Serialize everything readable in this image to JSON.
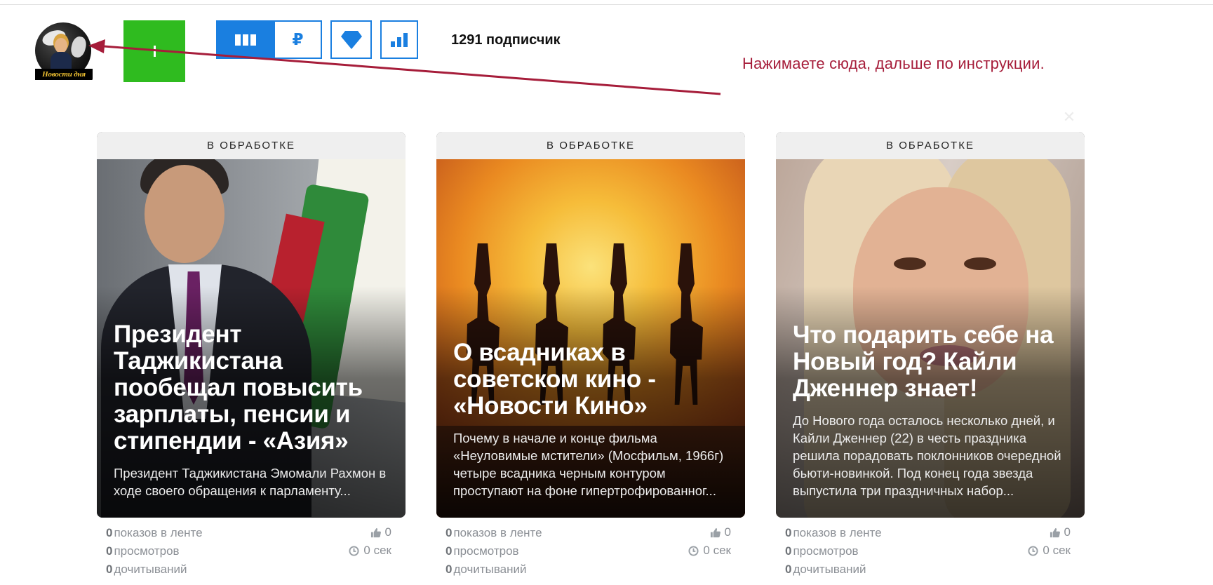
{
  "header": {
    "avatar_logo_text": "Новости дня",
    "subscribers_label": "1291 подписчик",
    "hint_text": "Нажимаете сюда, дальше по инструкции.",
    "money_icon": "₽"
  },
  "icons": {
    "add": "plus-icon",
    "feed": "grid-icon",
    "money": "ruble-icon",
    "gem": "diamond-icon",
    "stats": "bar-chart-icon",
    "close": "close-icon",
    "likes": "thumb-up-icon",
    "time": "clock-icon"
  },
  "colors": {
    "accent_blue": "#1a7fe0",
    "add_green": "#2fbb1f",
    "hint_red": "#a61d3a",
    "arrow_red": "#a61d3a"
  },
  "cards": [
    {
      "status": "В ОБРАБОТКЕ",
      "title": "Президент Таджикистана пообещал повысить зарплаты, пенсии и стипендии - «Азия»",
      "excerpt": "Президент Таджикистана Эмомали Рахмон в ходе своего обращения к парламенту...",
      "impressions_value": "0",
      "impressions_label": "показов в ленте",
      "views_value": "0",
      "views_label": "просмотров",
      "reads_value": "0",
      "reads_label": "дочитываний",
      "likes": "0",
      "time": "0 сек"
    },
    {
      "status": "В ОБРАБОТКЕ",
      "title": "О всадниках в советском кино - «Новости Кино»",
      "excerpt": "Почему в начале и конце фильма «Неуловимые мстители» (Мосфильм, 1966г) четыре всадника черным контуром проступают на фоне гипертрофированног...",
      "impressions_value": "0",
      "impressions_label": "показов в ленте",
      "views_value": "0",
      "views_label": "просмотров",
      "reads_value": "0",
      "reads_label": "дочитываний",
      "likes": "0",
      "time": "0 сек"
    },
    {
      "status": "В ОБРАБОТКЕ",
      "title": "Что подарить себе на Новый год? Кайли Дженнер знает!",
      "excerpt": "До Нового года осталось несколько дней, и Кайли Дженнер (22) в честь праздника решила порадовать поклонников очередной бьюти-новинкой. Под конец года звезда выпустила три праздничных набор...",
      "impressions_value": "0",
      "impressions_label": "показов в ленте",
      "views_value": "0",
      "views_label": "просмотров",
      "reads_value": "0",
      "reads_label": "дочитываний",
      "likes": "0",
      "time": "0 сек"
    }
  ]
}
